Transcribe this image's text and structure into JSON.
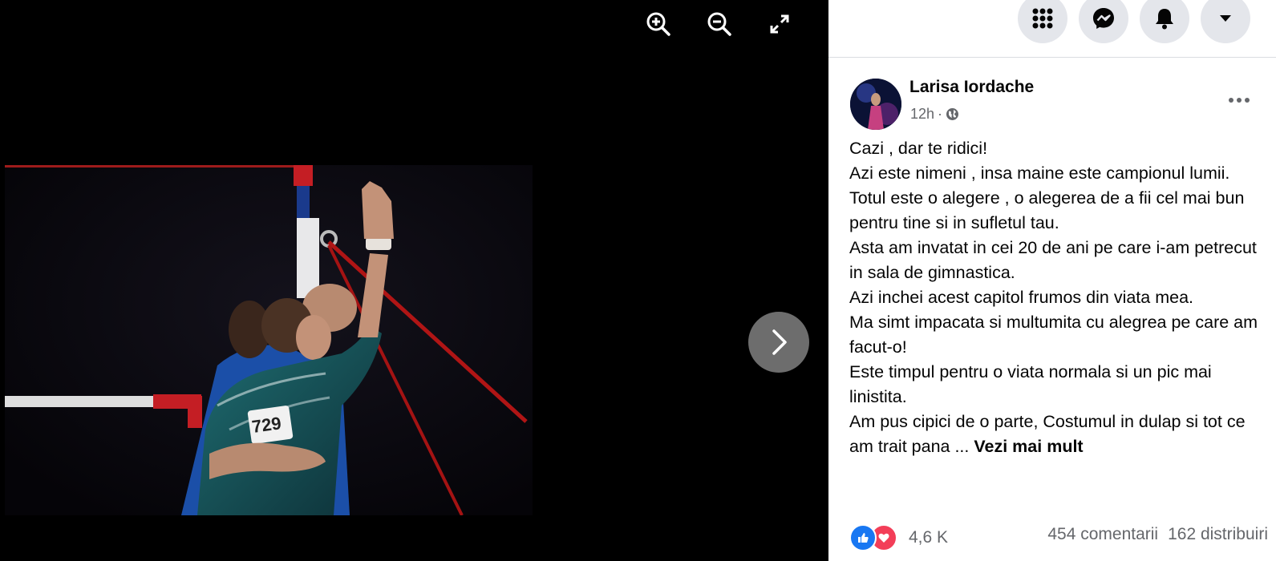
{
  "viewer": {
    "tools": [
      {
        "icon": "zoom-in-icon"
      },
      {
        "icon": "zoom-out-icon"
      },
      {
        "icon": "fullscreen-icon"
      }
    ],
    "photo_bib": "729",
    "next_icon": "chevron-right-icon"
  },
  "topbar": {
    "icons": [
      "menu-grid-icon",
      "messenger-icon",
      "bell-icon",
      "caret-down-icon"
    ]
  },
  "post": {
    "author": "Larisa Iordache",
    "time": "12h",
    "separator": "·",
    "privacy_icon": "globe-icon",
    "lines": [
      "Cazi , dar te ridici!",
      "Azi este nimeni , insa maine este campionul lumii.",
      "Totul este o alegere , o alegerea de a fii cel mai bun pentru tine si in sufletul tau.",
      "Asta am invatat in cei 20 de ani pe care i-am petrecut in sala de gimnastica.",
      "Azi inchei acest capitol frumos din viata mea.",
      "Ma simt impacata si multumita cu alegrea pe care am facut-o!",
      "Este timpul pentru o viata normala si un pic mai linistita."
    ],
    "last_line": "Am pus cipici de o parte, Costumul in dulap si tot ce am trait pana ...",
    "see_more": "Vezi mai mult"
  },
  "footer": {
    "reaction_count": "4,6 K",
    "comments": "454 comentarii",
    "shares": "162 distribuiri"
  },
  "colors": {
    "like_blue": "#1877f2",
    "love_red": "#f33e58",
    "secondary_text": "#65676b"
  }
}
